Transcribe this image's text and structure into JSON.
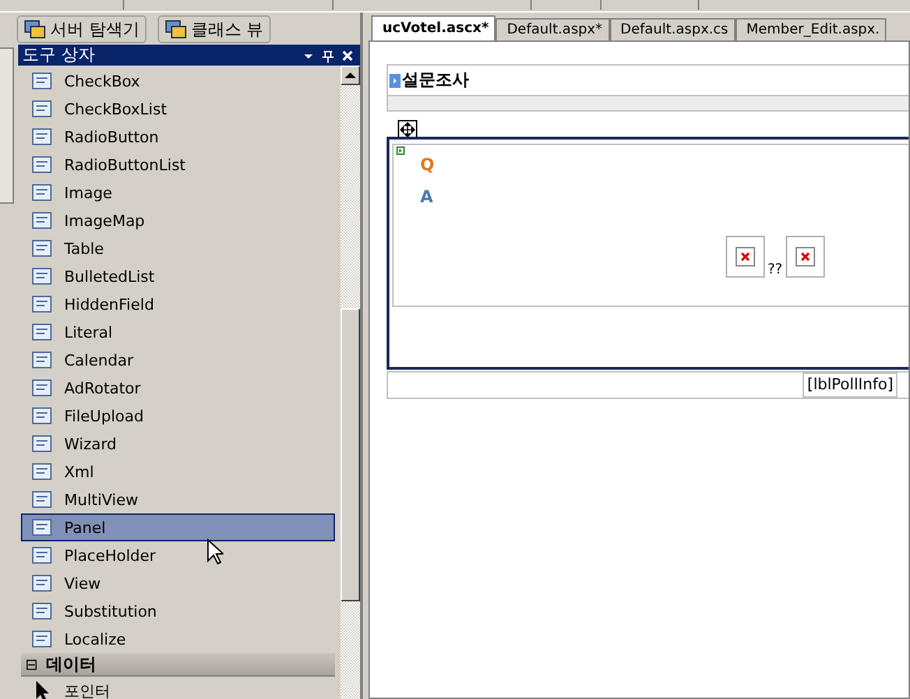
{
  "toolbar": {
    "buttons": [
      {
        "label": "서버 탐색기"
      },
      {
        "label": "클래스 뷰"
      }
    ]
  },
  "toolbox": {
    "title": "도구 상자",
    "items": [
      {
        "label": "CheckBox",
        "selected": false
      },
      {
        "label": "CheckBoxList",
        "selected": false
      },
      {
        "label": "RadioButton",
        "selected": false
      },
      {
        "label": "RadioButtonList",
        "selected": false
      },
      {
        "label": "Image",
        "selected": false
      },
      {
        "label": "ImageMap",
        "selected": false
      },
      {
        "label": "Table",
        "selected": false
      },
      {
        "label": "BulletedList",
        "selected": false
      },
      {
        "label": "HiddenField",
        "selected": false
      },
      {
        "label": "Literal",
        "selected": false
      },
      {
        "label": "Calendar",
        "selected": false
      },
      {
        "label": "AdRotator",
        "selected": false
      },
      {
        "label": "FileUpload",
        "selected": false
      },
      {
        "label": "Wizard",
        "selected": false
      },
      {
        "label": "Xml",
        "selected": false
      },
      {
        "label": "MultiView",
        "selected": false
      },
      {
        "label": "Panel",
        "selected": true
      },
      {
        "label": "PlaceHolder",
        "selected": false
      },
      {
        "label": "View",
        "selected": false
      },
      {
        "label": "Substitution",
        "selected": false
      },
      {
        "label": "Localize",
        "selected": false
      }
    ],
    "section": {
      "toggle": "⊟",
      "label": "데이터",
      "items": [
        {
          "label": "포인터"
        }
      ]
    }
  },
  "editor": {
    "tabs": [
      {
        "label": "ucVotel.ascx*",
        "selected": true
      },
      {
        "label": "Default.aspx*",
        "selected": false
      },
      {
        "label": "Default.aspx.cs",
        "selected": false
      },
      {
        "label": "Member_Edit.aspx.",
        "selected": false
      }
    ],
    "design": {
      "heading": "설문조사",
      "question": "Q",
      "answer": "A",
      "separator": "??",
      "label": "[lblPollInfo]"
    }
  }
}
